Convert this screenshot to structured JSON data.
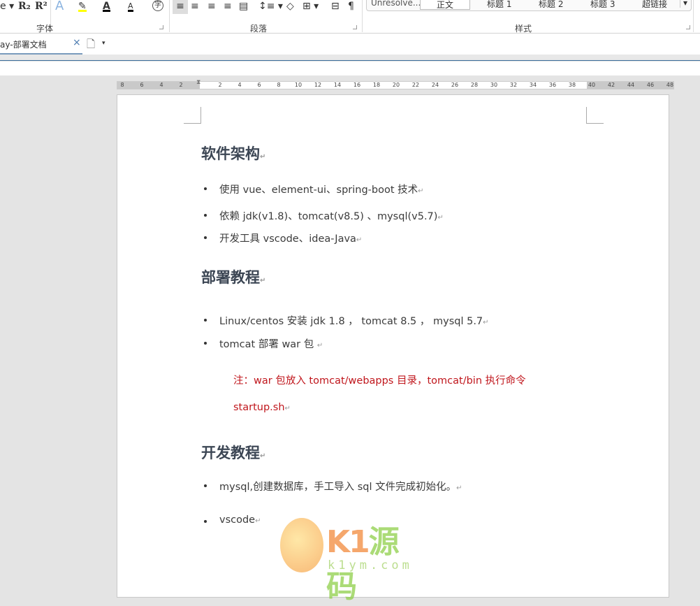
{
  "ribbon": {
    "font_group": "字体",
    "paragraph_group": "段落",
    "styles_group": "样式",
    "tools": [
      "R₂",
      "R²",
      "A",
      "A",
      "A",
      "字",
      "¶"
    ],
    "styles": [
      "Unresolve...",
      "正文",
      "标题 1",
      "标题 2",
      "标题 3",
      "超链接"
    ]
  },
  "tabbar": {
    "doc_tab": "ay-部署文档",
    "close": "×"
  },
  "ruler": {
    "ticks": [
      "8",
      "6",
      "4",
      "2",
      "2",
      "4",
      "6",
      "8",
      "10",
      "12",
      "14",
      "16",
      "18",
      "20",
      "22",
      "24",
      "26",
      "28",
      "30",
      "32",
      "34",
      "36",
      "38",
      "40",
      "42",
      "44",
      "46",
      "48"
    ]
  },
  "document": {
    "sections": [
      {
        "heading": "软件架构",
        "items": [
          "使用 vue、element-ui、spring-boot 技术",
          "依赖 jdk(v1.8)、tomcat(v8.5) 、mysql(v5.7)",
          "开发工具 vscode、idea-Java"
        ]
      },
      {
        "heading": "部署教程",
        "items": [
          "Linux/centos  安装 jdk 1.8 ， tomcat 8.5 ， mysql 5.7",
          "tomcat  部署 war 包 "
        ],
        "note": [
          "注：war 包放入 tomcat/webapps 目录，tomcat/bin  执行命令",
          "startup.sh"
        ]
      },
      {
        "heading": "开发教程",
        "items": [
          "mysql,创建数据库，手工导入 sql 文件完成初始化。",
          "vscode"
        ]
      }
    ],
    "paragraph_mark": "↵",
    "note_color": "#c0161c"
  },
  "watermark": {
    "brand": "K1源码",
    "url": "k1ym.com"
  }
}
